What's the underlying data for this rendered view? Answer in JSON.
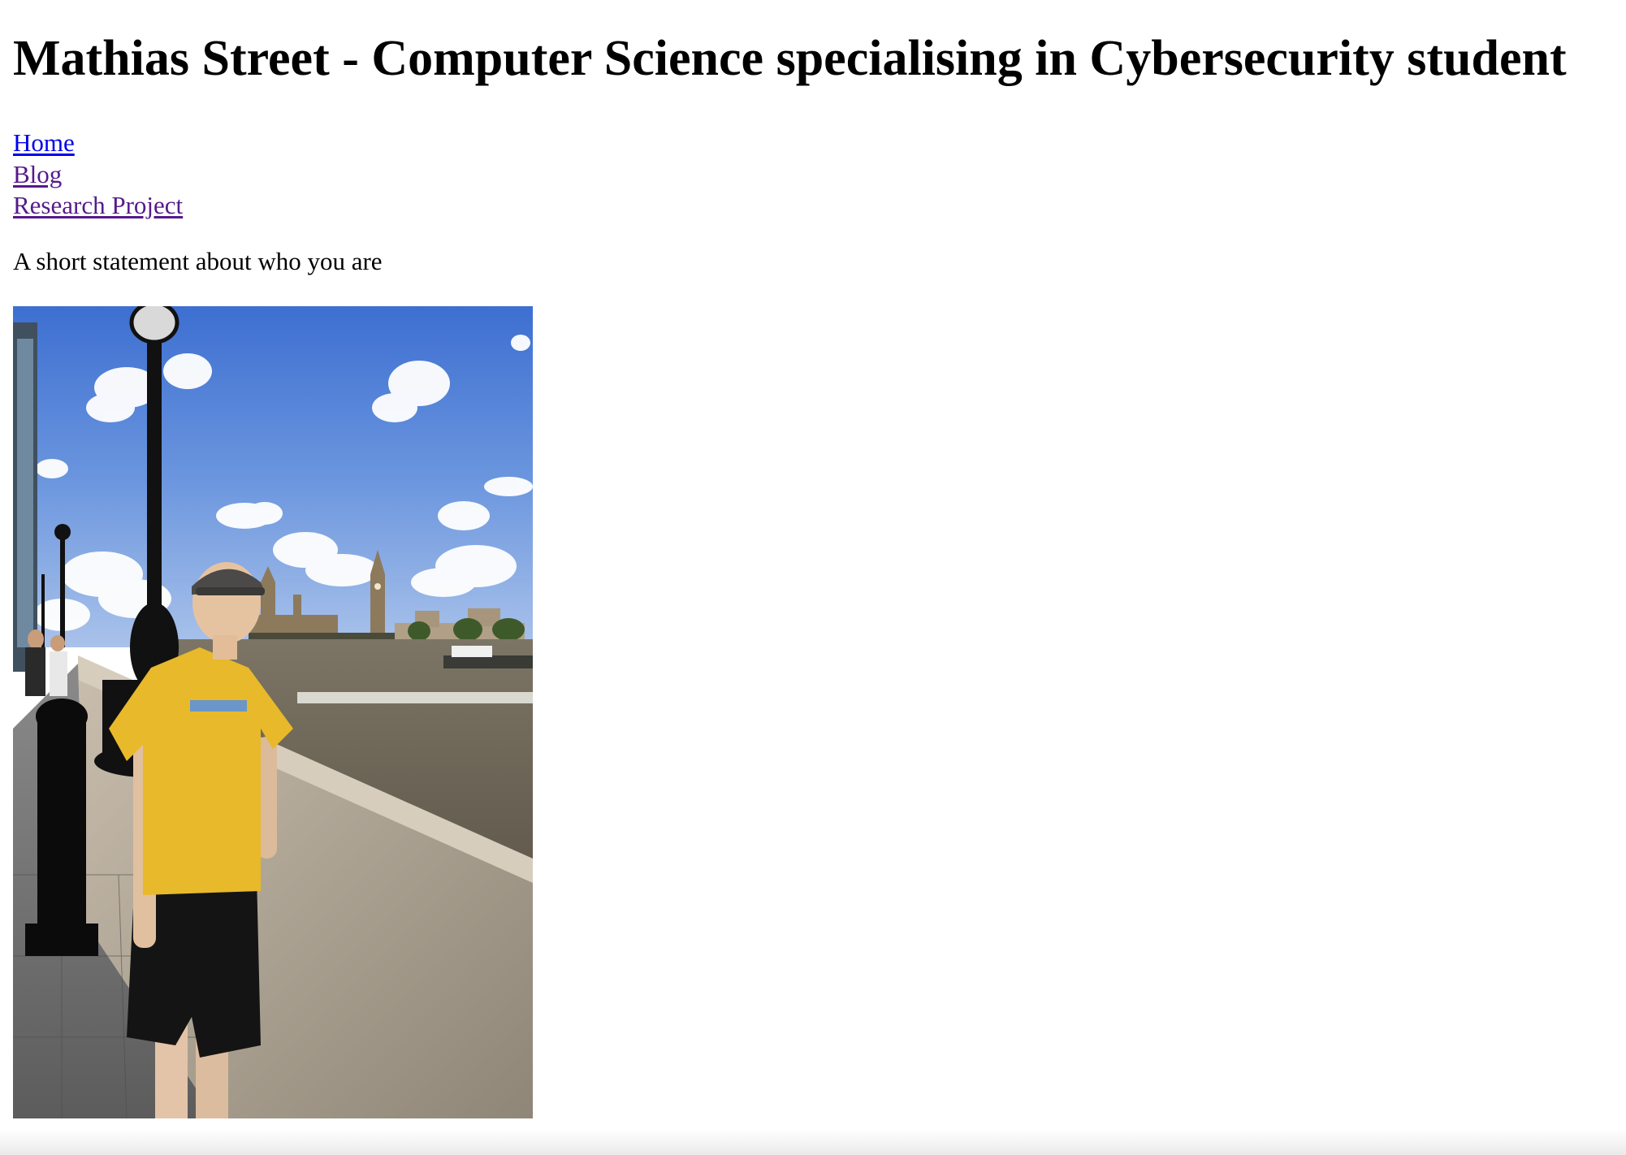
{
  "page": {
    "heading": "Mathias Street - Computer Science specialising in Cybersecurity student"
  },
  "nav": {
    "items": [
      {
        "label": "Home",
        "state": "unvisited"
      },
      {
        "label": "Blog",
        "state": "visited"
      },
      {
        "label": "Research Project",
        "state": "visited"
      }
    ]
  },
  "intro": {
    "statement": "A short statement about who you are"
  },
  "photo": {
    "description_icon": "profile-photo"
  },
  "colors": {
    "link_unvisited": "#0000ee",
    "link_visited": "#551a8b",
    "text": "#000000",
    "background": "#ffffff"
  }
}
